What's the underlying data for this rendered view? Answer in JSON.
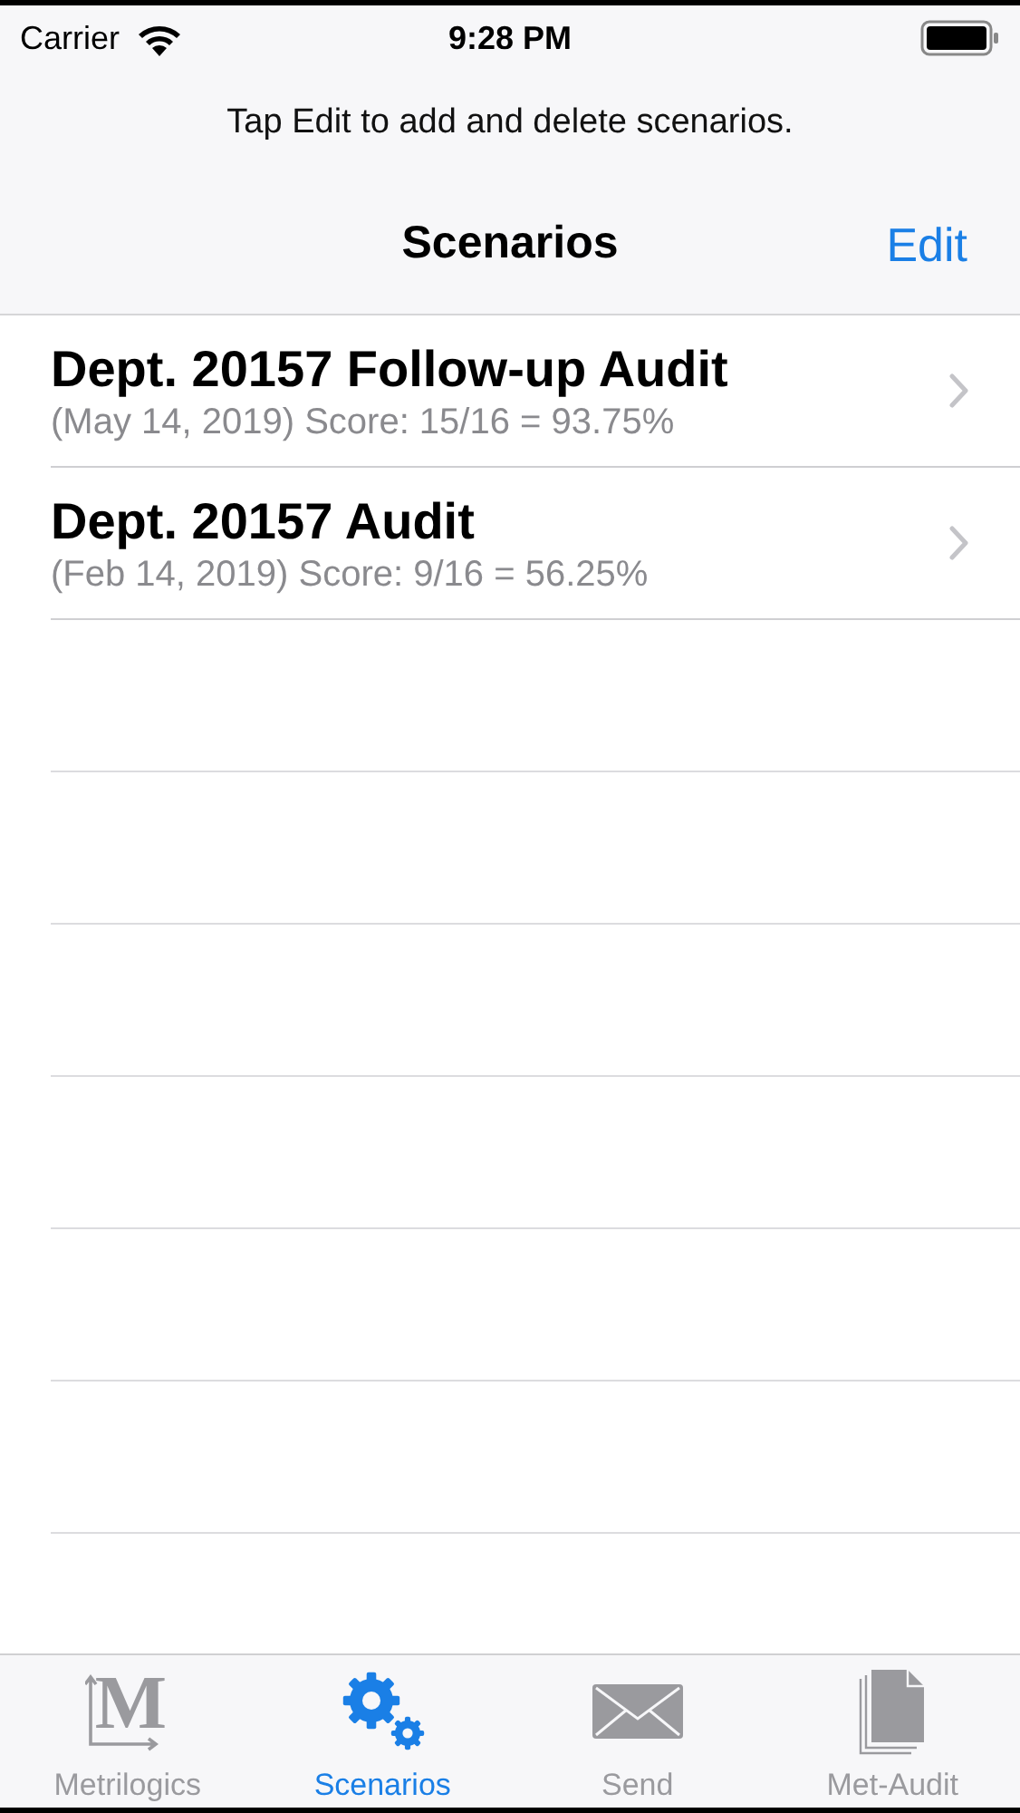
{
  "status_bar": {
    "carrier": "Carrier",
    "time": "9:28 PM"
  },
  "hint": "Tap Edit to add and delete scenarios.",
  "nav": {
    "title": "Scenarios",
    "edit": "Edit"
  },
  "rows": [
    {
      "title": "Dept. 20157 Follow-up Audit",
      "subtitle": "(May 14, 2019) Score: 15/16 = 93.75%"
    },
    {
      "title": "Dept. 20157 Audit",
      "subtitle": "(Feb 14, 2019) Score: 9/16 = 56.25%"
    }
  ],
  "tabs": [
    {
      "kind": "logo",
      "label": "Metrilogics",
      "icon_glyph": "M",
      "selected": false
    },
    {
      "kind": "gears",
      "label": "Scenarios",
      "selected": true
    },
    {
      "kind": "envelope",
      "label": "Send",
      "selected": false
    },
    {
      "kind": "pages",
      "label": "Met-Audit",
      "selected": false
    }
  ]
}
